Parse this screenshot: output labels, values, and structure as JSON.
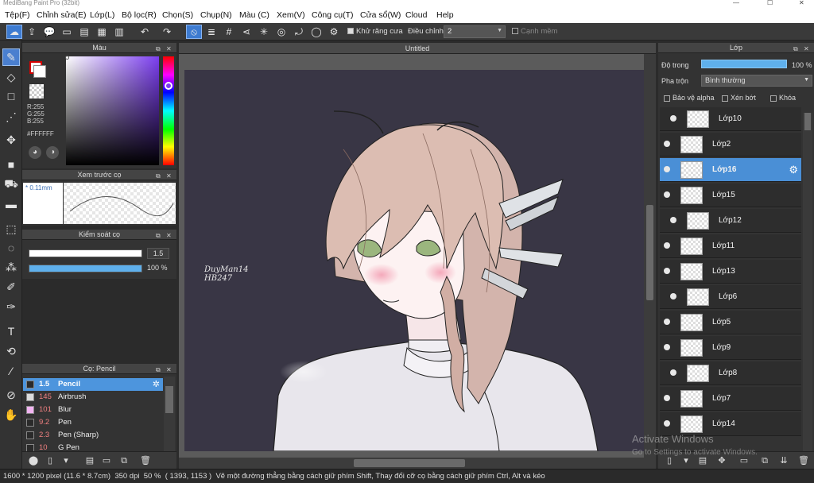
{
  "window": {
    "title": "MediBang Paint Pro (32bit)"
  },
  "menu": [
    "Tệp(F)",
    "Chỉnh sửa(E)",
    "Lớp(L)",
    "Bộ lọc(R)",
    "Chọn(S)",
    "Chụp(N)",
    "Màu (C)",
    "Xem(V)",
    "Công cụ(T)",
    "Cửa sổ(W)",
    "Cloud",
    "Help"
  ],
  "toolbar": {
    "antialias_label": "Khử răng cưa",
    "antialias_checked": true,
    "adjust_label": "Điều chỉnh",
    "adjust_value": "2",
    "soft_edge_label": "Cạnh mềm",
    "soft_edge_checked": false
  },
  "color_panel": {
    "title": "Màu",
    "r": "R:255",
    "g": "G:255",
    "b": "B:255",
    "hex": "#FFFFFF",
    "primary_color": "#ffffff",
    "secondary_color": "#d40000"
  },
  "brush_preview": {
    "title": "Xem trước cọ",
    "size_label": "* 0.11mm"
  },
  "brush_control": {
    "title": "Kiểm soát cọ",
    "size_value": "1.5",
    "opacity_value": "100 %",
    "opacity_fraction": 1.0
  },
  "brush_list": {
    "title": "Cọ: Pencil",
    "items": [
      {
        "size": "1.5",
        "name": "Pencil",
        "color": "#2a2a2a",
        "selected": true
      },
      {
        "size": "145",
        "name": "Airbrush",
        "color": "#dcdcdc",
        "selected": false
      },
      {
        "size": "101",
        "name": "Blur",
        "color": "#f2b4f2",
        "selected": false
      },
      {
        "size": "9.2",
        "name": "Pen",
        "color": "#2a2a2a",
        "selected": false
      },
      {
        "size": "2.3",
        "name": "Pen (Sharp)",
        "color": "#2a2a2a",
        "selected": false
      },
      {
        "size": "10",
        "name": "G Pen",
        "color": "#2a2a2a",
        "selected": false
      }
    ]
  },
  "canvas": {
    "tab_title": "Untitled",
    "signature": "DuyMan14 HB247"
  },
  "layers": {
    "title": "Lớp",
    "opacity_label": "Độ trong",
    "opacity_value": "100 %",
    "blend_label": "Pha trộn",
    "blend_value": "Bình thường",
    "protect_alpha_label": "Bảo vệ alpha",
    "clipping_label": "Xén bớt",
    "lock_label": "Khóa",
    "items": [
      {
        "name": "Lớp10",
        "selected": false,
        "indent": true
      },
      {
        "name": "Lớp2",
        "selected": false,
        "indent": false
      },
      {
        "name": "Lớp16",
        "selected": true,
        "indent": false
      },
      {
        "name": "Lớp15",
        "selected": false,
        "indent": false
      },
      {
        "name": "Lớp12",
        "selected": false,
        "indent": true
      },
      {
        "name": "Lớp11",
        "selected": false,
        "indent": false
      },
      {
        "name": "Lớp13",
        "selected": false,
        "indent": false
      },
      {
        "name": "Lớp6",
        "selected": false,
        "indent": true
      },
      {
        "name": "Lớp5",
        "selected": false,
        "indent": false
      },
      {
        "name": "Lớp9",
        "selected": false,
        "indent": false
      },
      {
        "name": "Lớp8",
        "selected": false,
        "indent": true
      },
      {
        "name": "Lớp7",
        "selected": false,
        "indent": false
      },
      {
        "name": "Lớp14",
        "selected": false,
        "indent": false
      }
    ]
  },
  "status": {
    "size": "1600 * 1200 pixel",
    "physical": "(11.6 * 8.7cm)",
    "dpi": "350 dpi",
    "zoom": "50 %",
    "coords": "( 1393, 1153 )",
    "hint": "Vẽ một đường thẳng bằng cách giữ phím Shift, Thay đổi cỡ cọ bằng cách giữ phím Ctrl, Alt và kéo"
  },
  "watermark": {
    "line1": "Activate Windows",
    "line2": "Go to Settings to activate Windows."
  }
}
